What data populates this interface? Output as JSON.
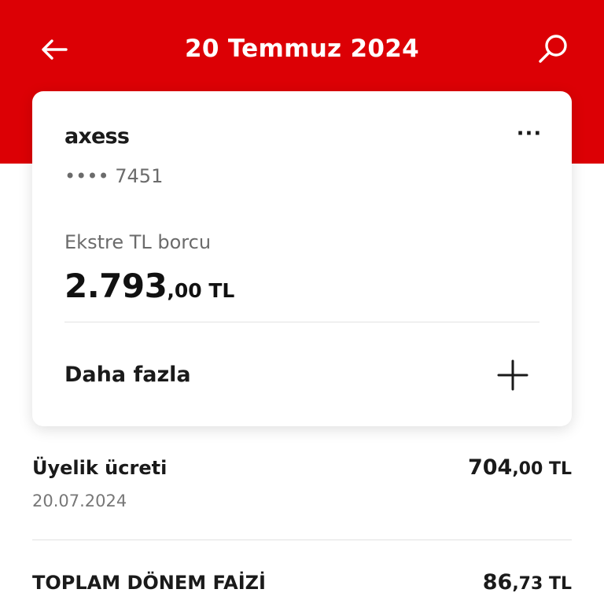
{
  "header": {
    "title": "20 Temmuz 2024",
    "background_color": "#dc0005",
    "back_icon": "arrow-left-icon",
    "search_icon": "search-icon"
  },
  "card": {
    "brand": "axess",
    "more_icon": "ellipsis-icon",
    "more_label": "···",
    "masked_number": "•••• 7451",
    "balance_label": "Ekstre TL borcu",
    "balance_integer": "2.793",
    "balance_decimal": ",00 TL",
    "expand_label": "Daha fazla",
    "expand_icon": "plus-icon"
  },
  "transactions": [
    {
      "name": "Üyelik ücreti",
      "date": "20.07.2024",
      "amount_integer": "704",
      "amount_decimal": ",00 TL"
    },
    {
      "name": "TOPLAM DÖNEM FAİZİ",
      "amount_integer": "86",
      "amount_decimal": ",73 TL"
    }
  ]
}
